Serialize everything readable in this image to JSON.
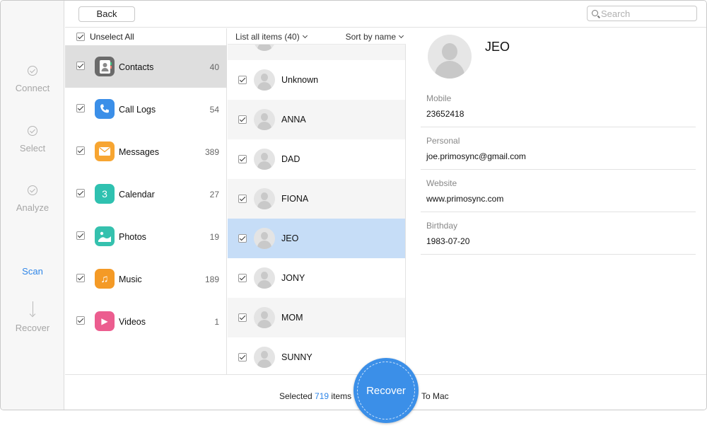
{
  "toolbar": {
    "back_label": "Back",
    "search_placeholder": "Search"
  },
  "steps": [
    {
      "label": "Connect",
      "state": "done"
    },
    {
      "label": "Select",
      "state": "done"
    },
    {
      "label": "Analyze",
      "state": "done"
    },
    {
      "label": "Scan",
      "state": "active"
    },
    {
      "label": "Recover",
      "state": "pending"
    }
  ],
  "categories": {
    "unselect_all_label": "Unselect All",
    "items": [
      {
        "label": "Contacts",
        "count": "40",
        "icon": "contacts-icon",
        "color": "#6b6b6b",
        "selected": true
      },
      {
        "label": "Call Logs",
        "count": "54",
        "icon": "phone-icon",
        "color": "#3b8fe8"
      },
      {
        "label": "Messages",
        "count": "389",
        "icon": "envelope-icon",
        "color": "#f7a531"
      },
      {
        "label": "Calendar",
        "count": "27",
        "icon": "calendar-icon",
        "color": "#2fc1b0",
        "glyph": "3"
      },
      {
        "label": "Photos",
        "count": "19",
        "icon": "photos-icon",
        "color": "#35c1ae"
      },
      {
        "label": "Music",
        "count": "189",
        "icon": "music-note-icon",
        "color": "#f49a26",
        "glyph": "♫"
      },
      {
        "label": "Videos",
        "count": "1",
        "icon": "video-play-icon",
        "color": "#ec5d8f",
        "glyph": "▶"
      }
    ]
  },
  "items_list": {
    "list_all_label": "List all items (40)",
    "sort_label": "Sort by name",
    "rows": [
      {
        "name": "Unknown"
      },
      {
        "name": "ANNA"
      },
      {
        "name": "DAD"
      },
      {
        "name": "FIONA"
      },
      {
        "name": "JEO",
        "selected": true
      },
      {
        "name": "JONY"
      },
      {
        "name": "MOM"
      },
      {
        "name": "SUNNY"
      }
    ]
  },
  "detail": {
    "name": "JEO",
    "fields": [
      {
        "label": "Mobile",
        "value": "23652418"
      },
      {
        "label": "Personal",
        "value": "joe.primosync@gmail.com"
      },
      {
        "label": "Website",
        "value": "www.primosync.com"
      },
      {
        "label": "Birthday",
        "value": "1983-07-20"
      }
    ]
  },
  "bottom": {
    "selected_prefix": "Selected",
    "selected_count": "719",
    "selected_suffix": "items",
    "recover_label": "Recover",
    "destination": "To Mac"
  },
  "colors": {
    "accent": "#2f86e8",
    "selected_row": "#c6ddf7",
    "recover_button": "#3b8fe8"
  }
}
